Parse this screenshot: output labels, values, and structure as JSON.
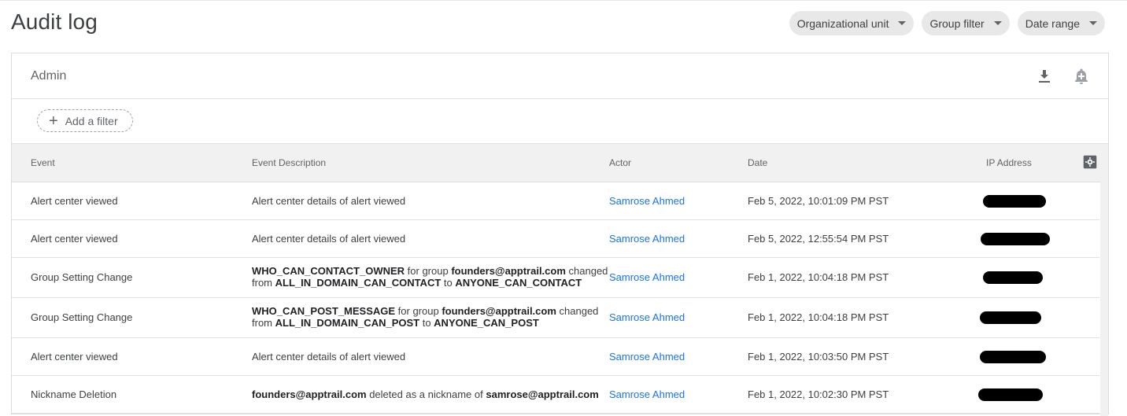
{
  "page": {
    "title": "Audit log"
  },
  "filters_bar": {
    "chips": [
      {
        "label": "Organizational unit"
      },
      {
        "label": "Group filter"
      },
      {
        "label": "Date range"
      }
    ]
  },
  "card": {
    "title": "Admin",
    "actions": {
      "download_icon": "download-icon",
      "alert_icon": "add-alert-icon"
    },
    "add_filter_label": "Add a filter"
  },
  "table": {
    "columns": [
      "Event",
      "Event Description",
      "Actor",
      "Date",
      "IP Address"
    ],
    "settings_icon": "gear-icon",
    "rows": [
      {
        "event": "Alert center viewed",
        "description": [
          {
            "t": "Alert center details of alert viewed",
            "b": false
          }
        ],
        "actor": "Samrose Ahmed",
        "date": "Feb 5, 2022, 10:01:09 PM PST"
      },
      {
        "event": "Alert center viewed",
        "description": [
          {
            "t": "Alert center details of alert viewed",
            "b": false
          }
        ],
        "actor": "Samrose Ahmed",
        "date": "Feb 5, 2022, 12:55:54 PM PST"
      },
      {
        "event": "Group Setting Change",
        "description": [
          {
            "t": "WHO_CAN_CONTACT_OWNER",
            "b": true
          },
          {
            "t": " for group ",
            "b": false
          },
          {
            "t": "founders@apptrail.com",
            "b": true
          },
          {
            "t": " changed",
            "b": false
          },
          {
            "br": true
          },
          {
            "t": "from ",
            "b": false
          },
          {
            "t": "ALL_IN_DOMAIN_CAN_CONTACT",
            "b": true
          },
          {
            "t": " to ",
            "b": false
          },
          {
            "t": "ANYONE_CAN_CONTACT",
            "b": true
          }
        ],
        "actor": "Samrose Ahmed",
        "date": "Feb 1, 2022, 10:04:18 PM PST"
      },
      {
        "event": "Group Setting Change",
        "description": [
          {
            "t": "WHO_CAN_POST_MESSAGE",
            "b": true
          },
          {
            "t": " for group ",
            "b": false
          },
          {
            "t": "founders@apptrail.com",
            "b": true
          },
          {
            "t": " changed",
            "b": false
          },
          {
            "br": true
          },
          {
            "t": "from ",
            "b": false
          },
          {
            "t": "ALL_IN_DOMAIN_CAN_POST",
            "b": true
          },
          {
            "t": " to ",
            "b": false
          },
          {
            "t": "ANYONE_CAN_POST",
            "b": true
          }
        ],
        "actor": "Samrose Ahmed",
        "date": "Feb 1, 2022, 10:04:18 PM PST"
      },
      {
        "event": "Alert center viewed",
        "description": [
          {
            "t": "Alert center details of alert viewed",
            "b": false
          }
        ],
        "actor": "Samrose Ahmed",
        "date": "Feb 1, 2022, 10:03:50 PM PST"
      },
      {
        "event": "Nickname Deletion",
        "description": [
          {
            "t": "founders@apptrail.com",
            "b": true
          },
          {
            "t": " deleted as a nickname of ",
            "b": false
          },
          {
            "t": "samrose@apptrail.com",
            "b": true
          }
        ],
        "actor": "Samrose Ahmed",
        "date": "Feb 1, 2022, 10:02:30 PM PST"
      }
    ]
  },
  "colors": {
    "accent": "#1a73e8",
    "header_bg": "#f1f1f1",
    "chip_bg": "#e8e8e8"
  }
}
